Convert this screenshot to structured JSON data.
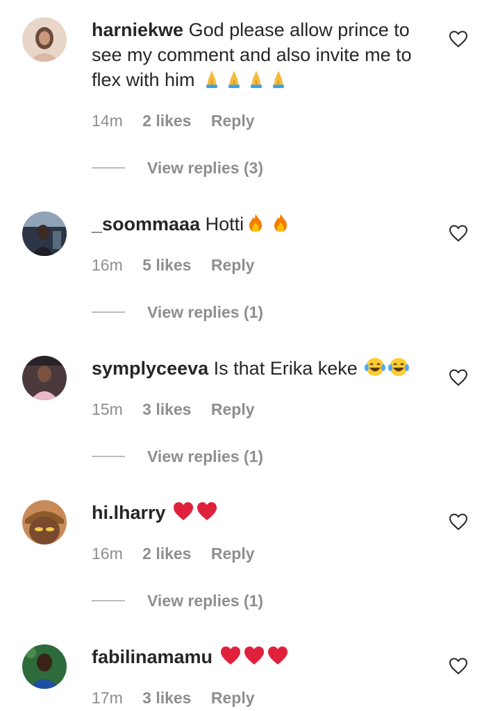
{
  "comments": [
    {
      "username": "harniekwe",
      "text": "God please allow prince to see my comment and also invite me to flex with him",
      "emoji": [
        "folded-hands",
        "folded-hands",
        "folded-hands",
        "folded-hands"
      ],
      "time": "14m",
      "likes": "2 likes",
      "reply_label": "Reply",
      "view_replies": "View replies (3)"
    },
    {
      "username": "_soommaaa",
      "text": "Hotti",
      "emoji": [
        "fire",
        "fire"
      ],
      "time": "16m",
      "likes": "5 likes",
      "reply_label": "Reply",
      "view_replies": "View replies (1)"
    },
    {
      "username": "symplyceeva",
      "text": "Is that Erika keke",
      "emoji": [
        "tears-of-joy",
        "tears-of-joy"
      ],
      "time": "15m",
      "likes": "3 likes",
      "reply_label": "Reply",
      "view_replies": "View replies (1)"
    },
    {
      "username": "hi.lharry",
      "text": "",
      "emoji": [
        "red-heart",
        "red-heart"
      ],
      "time": "16m",
      "likes": "2 likes",
      "reply_label": "Reply",
      "view_replies": "View replies (1)"
    },
    {
      "username": "fabilinamamu",
      "text": "",
      "emoji": [
        "red-heart",
        "red-heart",
        "red-heart"
      ],
      "time": "17m",
      "likes": "3 likes",
      "reply_label": "Reply"
    }
  ],
  "colors": {
    "text": "#262626",
    "muted": "#8e8e8e",
    "divider": "#bdbdbd",
    "heart_red": "#e0213d"
  }
}
